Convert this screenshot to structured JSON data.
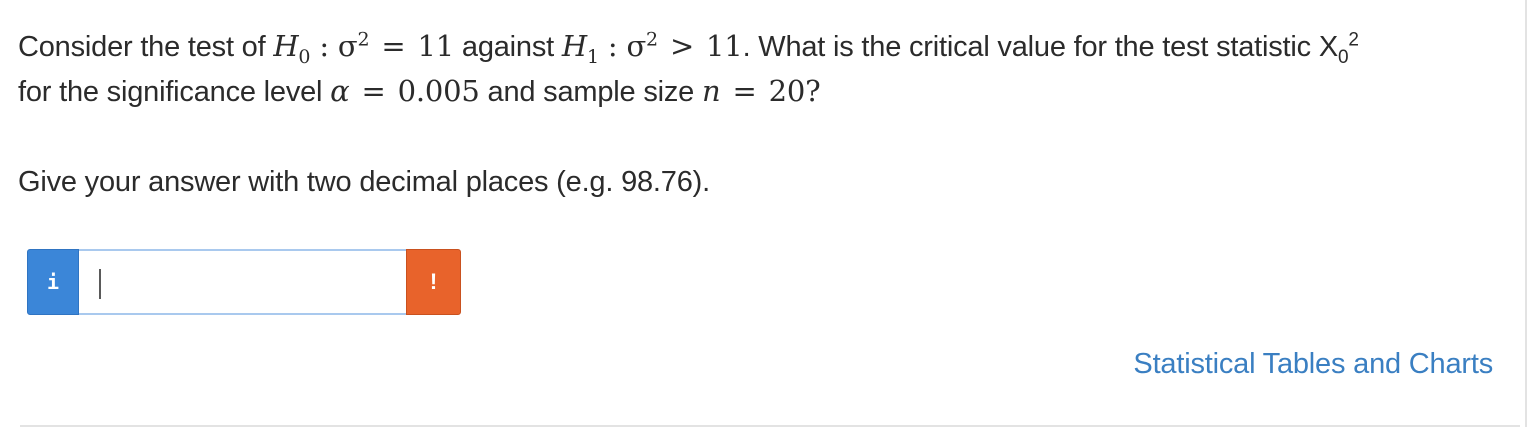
{
  "question": {
    "line1": {
      "intro": "Consider the test of ",
      "h0_symbol": "H",
      "h0_sub": "0",
      "h0_colon": " : σ",
      "h0_sigma_sup": "2",
      "h0_eq": "=",
      "h0_value": "11",
      "against": " against ",
      "h1_symbol": "H",
      "h1_sub": "1",
      "h1_colon": " : σ",
      "h1_sigma_sup": "2",
      "h1_gt": ">",
      "h1_value": "11",
      "rest": ". What is the critical value for the test statistic X",
      "stat_sub": "0",
      "stat_sup": "2"
    },
    "line2": {
      "intro": "for the significance level ",
      "alpha_symbol": "α",
      "alpha_eq": "=",
      "alpha_value": "0.005",
      "mid": " and sample size ",
      "n_symbol": "n",
      "n_eq": "=",
      "n_value": "20?"
    }
  },
  "instruction": "Give your answer with two decimal places (e.g. 98.76).",
  "answer": {
    "info_label": "i",
    "value": "",
    "alert_label": "!"
  },
  "link": {
    "label": "Statistical Tables and Charts"
  },
  "colors": {
    "info_button": "#3b86d8",
    "alert_button": "#e8632b",
    "link": "#3a7fc2",
    "input_border": "#a9c9ee"
  }
}
